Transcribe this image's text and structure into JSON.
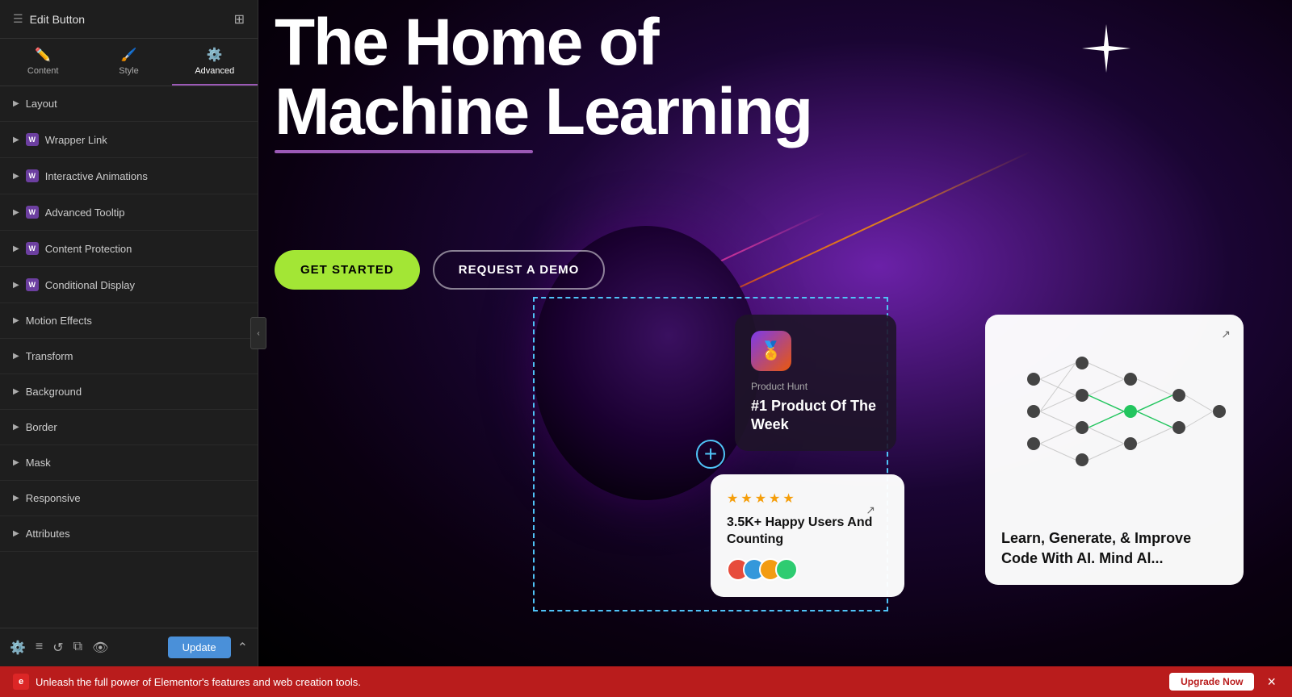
{
  "header": {
    "title": "Edit Button",
    "grid_icon": "⊞"
  },
  "tabs": [
    {
      "id": "content",
      "label": "Content",
      "icon": "✏️",
      "active": false
    },
    {
      "id": "style",
      "label": "Style",
      "icon": "🎨",
      "active": false
    },
    {
      "id": "advanced",
      "label": "Advanced",
      "icon": "⚙️",
      "active": true
    }
  ],
  "sections": [
    {
      "id": "layout",
      "label": "Layout",
      "has_badge": false
    },
    {
      "id": "wrapper-link",
      "label": "Wrapper Link",
      "has_badge": true
    },
    {
      "id": "interactive-animations",
      "label": "Interactive Animations",
      "has_badge": true
    },
    {
      "id": "advanced-tooltip",
      "label": "Advanced Tooltip",
      "has_badge": true
    },
    {
      "id": "content-protection",
      "label": "Content Protection",
      "has_badge": true
    },
    {
      "id": "conditional-display",
      "label": "Conditional Display",
      "has_badge": true
    },
    {
      "id": "motion-effects",
      "label": "Motion Effects",
      "has_badge": false
    },
    {
      "id": "transform",
      "label": "Transform",
      "has_badge": false
    },
    {
      "id": "background",
      "label": "Background",
      "has_badge": false
    },
    {
      "id": "border",
      "label": "Border",
      "has_badge": false
    },
    {
      "id": "mask",
      "label": "Mask",
      "has_badge": false
    },
    {
      "id": "responsive",
      "label": "Responsive",
      "has_badge": false
    },
    {
      "id": "attributes",
      "label": "Attributes",
      "has_badge": false
    }
  ],
  "hero": {
    "title_line1": "The Home of",
    "title_line2": "Machine Learning"
  },
  "buttons": {
    "get_started": "GET STARTED",
    "request_demo": "REQUEST A DEMO"
  },
  "cards": {
    "product_hunt": {
      "badge": "🏅",
      "subtitle": "Product Hunt",
      "title": "#1 Product Of The Week"
    },
    "happy_users": {
      "stars": 5,
      "arrow": "↗",
      "title": "3.5K+ Happy Users And Counting"
    },
    "neural": {
      "arrow": "↗",
      "title": "Learn, Generate, & Improve Code With AI. Mind Al..."
    }
  },
  "bottom_bar": {
    "logo": "e",
    "message": "Unleash the full power of Elementor's features and web creation tools.",
    "upgrade_label": "Upgrade Now",
    "close_icon": "×"
  },
  "toolbar": {
    "update_label": "Update"
  }
}
